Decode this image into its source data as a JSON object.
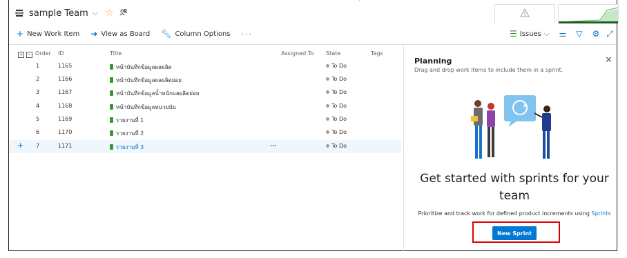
{
  "header": {
    "team_name": "sample Team",
    "chevron": "chevron-down-icon",
    "favorite": "star-icon",
    "team_members": "people-icon"
  },
  "toolbar": {
    "new_work_item": "New Work Item",
    "view_as_board": "View as Board",
    "column_options": "Column Options",
    "more": "···",
    "issues_filter": "Issues"
  },
  "table": {
    "columns": [
      "Order",
      "ID",
      "Title",
      "Assigned To",
      "State",
      "Tags"
    ],
    "rows": [
      {
        "order": "1",
        "id": "1165",
        "title": "หน้าบันทึกข้อมูลผลผลิต",
        "state": "To Do"
      },
      {
        "order": "2",
        "id": "1166",
        "title": "หน้าบันทึกข้อมูลผลผลิตย่อย",
        "state": "To Do"
      },
      {
        "order": "3",
        "id": "1167",
        "title": "หน้าบันทึกข้อมูลน้ำหนักผลผลิตย่อย",
        "state": "To Do"
      },
      {
        "order": "4",
        "id": "1168",
        "title": "หน้าบันทึกข้อมูลหน่วยนับ",
        "state": "To Do"
      },
      {
        "order": "5",
        "id": "1169",
        "title": "รายงานที่ 1",
        "state": "To Do"
      },
      {
        "order": "6",
        "id": "1170",
        "title": "รายงานที่ 2",
        "state": "To Do"
      },
      {
        "order": "7",
        "id": "1171",
        "title": "รายงานที่ 3",
        "state": "To Do"
      }
    ],
    "row_more": "···"
  },
  "planning": {
    "title": "Planning",
    "subtitle": "Drag and drop work items to include them in a sprint.",
    "headline": "Get started with sprints for your team",
    "description": "Prioritize and track work for defined product increments using",
    "link": "Sprints",
    "new_sprint": "New Sprint"
  },
  "colors": {
    "accent": "#0078d4",
    "work_item": "#339933",
    "highlight": "#e00000",
    "selected_row": "#eff6fc"
  }
}
